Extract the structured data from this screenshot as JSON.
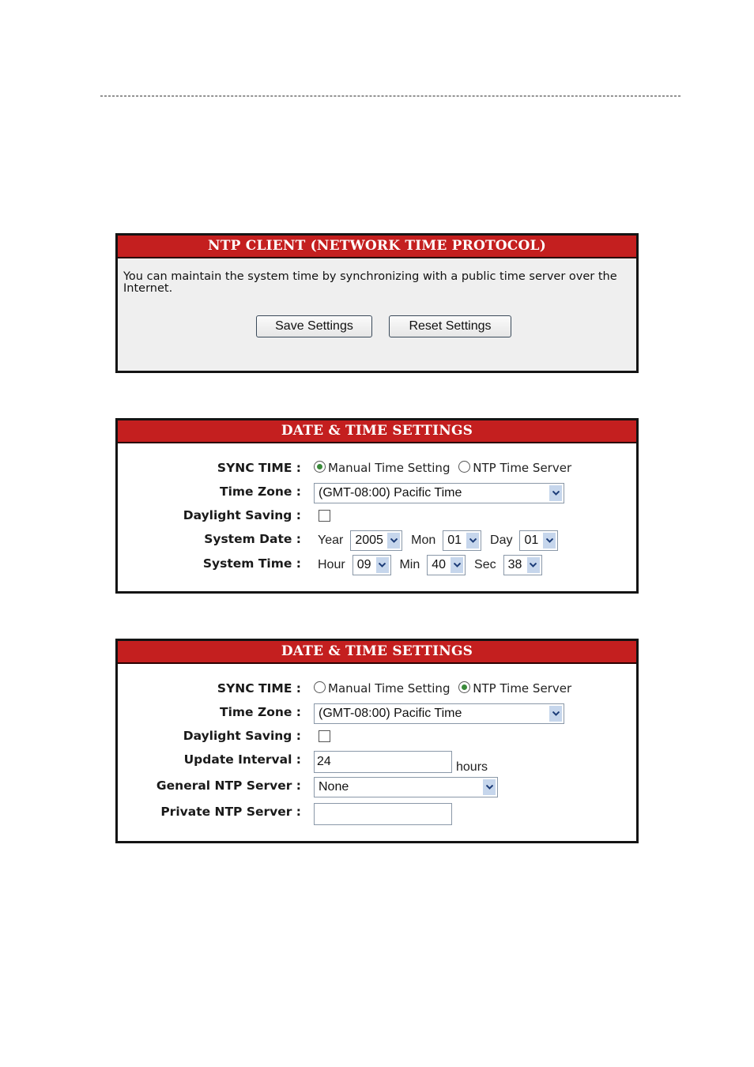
{
  "ntp_client_panel": {
    "title": "NTP CLIENT (NETWORK TIME PROTOCOL)",
    "description": "You can maintain the system time by synchronizing with a public time server over the Internet.",
    "save_label": "Save Settings",
    "reset_label": "Reset Settings"
  },
  "manual_panel": {
    "title": "DATE & TIME SETTINGS",
    "sync_time": {
      "label": "SYNC TIME :",
      "options": [
        "Manual Time Setting",
        "NTP Time Server"
      ],
      "selected": "Manual Time Setting"
    },
    "time_zone": {
      "label": "Time Zone :",
      "value": "(GMT-08:00) Pacific Time"
    },
    "daylight_saving": {
      "label": "Daylight Saving :",
      "checked": false
    },
    "system_date": {
      "label": "System Date :",
      "year_label": "Year",
      "year": "2005",
      "mon_label": "Mon",
      "mon": "01",
      "day_label": "Day",
      "day": "01"
    },
    "system_time": {
      "label": "System Time :",
      "hour_label": "Hour",
      "hour": "09",
      "min_label": "Min",
      "min": "40",
      "sec_label": "Sec",
      "sec": "38"
    }
  },
  "ntp_panel": {
    "title": "DATE & TIME SETTINGS",
    "sync_time": {
      "label": "SYNC TIME :",
      "options": [
        "Manual Time Setting",
        "NTP Time Server"
      ],
      "selected": "NTP Time Server"
    },
    "time_zone": {
      "label": "Time Zone :",
      "value": "(GMT-08:00) Pacific Time"
    },
    "daylight_saving": {
      "label": "Daylight Saving :",
      "checked": false
    },
    "update_interval": {
      "label": "Update Interval :",
      "value": "24",
      "unit": "hours"
    },
    "general_ntp_server": {
      "label": "General NTP Server :",
      "value": "None"
    },
    "private_ntp_server": {
      "label": "Private NTP Server :",
      "value": ""
    }
  },
  "colors": {
    "header_red": "#c41f1f",
    "panel_border": "#141414",
    "select_arrow_bg": "#c6d6ec"
  }
}
